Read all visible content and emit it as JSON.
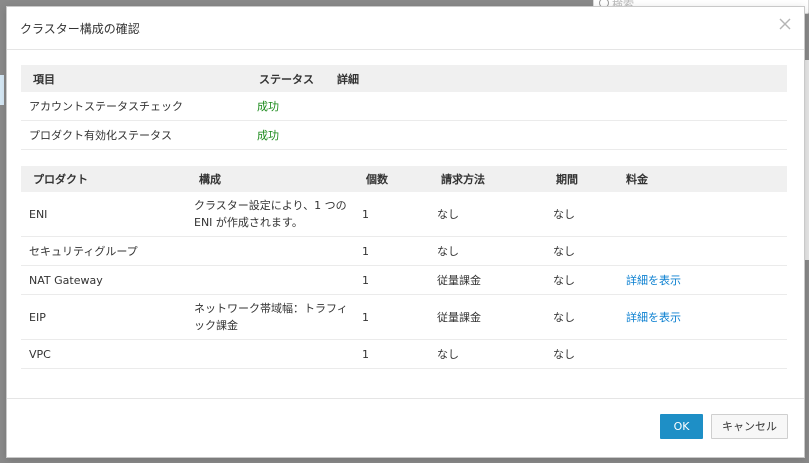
{
  "background": {
    "search_placeholder": "検索"
  },
  "dialog": {
    "title": "クラスター構成の確認",
    "status_table": {
      "headers": [
        "項目",
        "ステータス",
        "詳細"
      ],
      "rows": [
        {
          "item": "アカウントステータスチェック",
          "status": "成功",
          "detail": ""
        },
        {
          "item": "プロダクト有効化ステータス",
          "status": "成功",
          "detail": ""
        }
      ]
    },
    "product_table": {
      "headers": [
        "プロダクト",
        "構成",
        "個数",
        "請求方法",
        "期間",
        "料金"
      ],
      "rows": [
        {
          "product": "ENI",
          "config": "クラスター設定により、1 つの ENI が作成されます。",
          "count": "1",
          "billing": "なし",
          "period": "なし",
          "fee": ""
        },
        {
          "product": "セキュリティグループ",
          "config": "",
          "count": "1",
          "billing": "なし",
          "period": "なし",
          "fee": ""
        },
        {
          "product": "NAT Gateway",
          "config": "",
          "count": "1",
          "billing": "従量課金",
          "period": "なし",
          "fee": "詳細を表示"
        },
        {
          "product": "EIP",
          "config": "ネットワーク帯域幅：トラフィック課金",
          "count": "1",
          "billing": "従量課金",
          "period": "なし",
          "fee": "詳細を表示"
        },
        {
          "product": "VPC",
          "config": "",
          "count": "1",
          "billing": "なし",
          "period": "なし",
          "fee": ""
        }
      ]
    },
    "buttons": {
      "ok": "OK",
      "cancel": "キャンセル"
    }
  },
  "colors": {
    "accent": "#1e8fc6",
    "success": "#1a8a1a",
    "link": "#0a7fd0"
  },
  "icons": {
    "close": "close-icon",
    "search": "search-icon"
  }
}
